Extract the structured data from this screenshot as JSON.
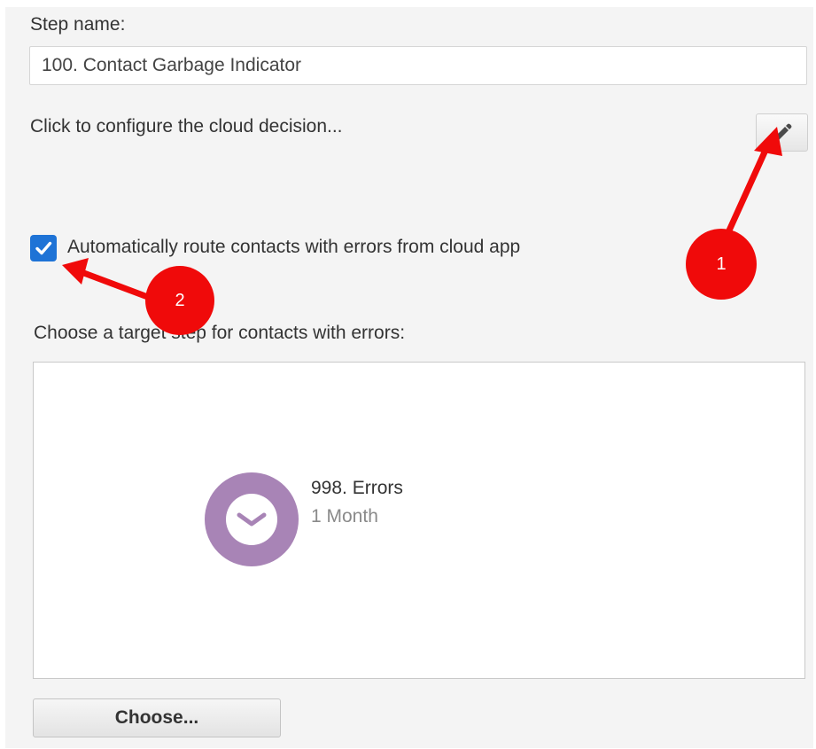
{
  "step_name": {
    "label": "Step name:",
    "value": "100. Contact Garbage Indicator"
  },
  "cloud_decision": {
    "prompt": "Click to configure the cloud decision...",
    "edit_icon": "pencil-icon"
  },
  "error_routing": {
    "checkbox_checked": true,
    "checkbox_label": "Automatically route contacts with errors from cloud app"
  },
  "target_step": {
    "label": "Choose a target step for contacts with errors:",
    "selected_step": {
      "title": "998. Errors",
      "subtitle": "1 Month",
      "icon": "clock-icon",
      "color": "#a884b6"
    },
    "choose_button": "Choose..."
  },
  "annotations": {
    "marker_1": "1",
    "marker_2": "2",
    "color": "#f00a0a"
  }
}
